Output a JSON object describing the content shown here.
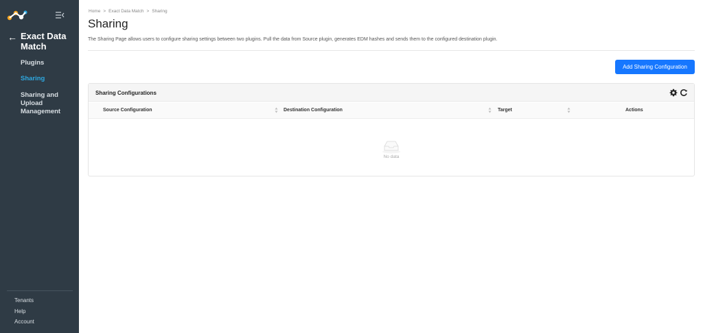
{
  "sidebar": {
    "app_title": "Exact Data Match",
    "items": [
      {
        "label": "Plugins"
      },
      {
        "label": "Sharing"
      },
      {
        "label": "Sharing and Upload Management"
      }
    ],
    "bottom": [
      "Tenants",
      "Help",
      "Account"
    ],
    "accent_color": "#2ea8e0"
  },
  "breadcrumb": [
    "Home",
    ">",
    "Exact Data Match",
    ">",
    "Sharing"
  ],
  "page": {
    "title": "Sharing",
    "description": "The Sharing Page allows users to configure sharing settings between two plugins. Pull the data from Source plugin, generates EDM hashes and sends them to the configured destination plugin.",
    "add_button": "Add Sharing Configuration"
  },
  "card": {
    "title": "Sharing Configurations",
    "columns": [
      "Source Configuration",
      "Destination Configuration",
      "Target",
      "Actions"
    ],
    "empty_text": "No data",
    "icons": [
      "gear-icon",
      "refresh-icon",
      "inbox-icon"
    ]
  }
}
